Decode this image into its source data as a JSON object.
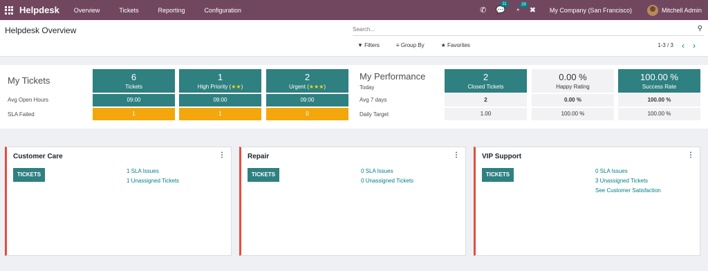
{
  "app": {
    "name": "Helpdesk",
    "menu": [
      "Overview",
      "Tickets",
      "Reporting",
      "Configuration"
    ]
  },
  "topbar": {
    "chat_badge": "11",
    "activity_badge": "29",
    "company": "My Company (San Francisco)",
    "user": "Mitchell Admin"
  },
  "control": {
    "title": "Helpdesk Overview",
    "search_placeholder": "Search...",
    "filters": "Filters",
    "group_by": "Group By",
    "favorites": "Favorites",
    "pager": "1-3 / 3"
  },
  "my_tickets": {
    "title": "My Tickets",
    "row_labels": [
      "Avg Open Hours",
      "SLA Failed"
    ],
    "cards": [
      {
        "value": "6",
        "label": "Tickets",
        "stars": "",
        "avg_open": "09:00",
        "sla_failed": "1"
      },
      {
        "value": "1",
        "label": "High Priority",
        "stars": "★★",
        "avg_open": "09:00",
        "sla_failed": "1"
      },
      {
        "value": "2",
        "label": "Urgent",
        "stars": "★★★",
        "avg_open": "09:00",
        "sla_failed": "0"
      }
    ]
  },
  "performance": {
    "title": "My Performance",
    "row_labels": [
      "Today",
      "Avg 7 days",
      "Daily Target"
    ],
    "cards": [
      {
        "value": "2",
        "label": "Closed Tickets",
        "avg7": "2",
        "target": "1.00"
      },
      {
        "value": "0.00 %",
        "label": "Happy Rating",
        "avg7": "0.00 %",
        "target": "100.00 %"
      },
      {
        "value": "100.00 %",
        "label": "Success Rate",
        "avg7": "100.00 %",
        "target": "100.00 %"
      }
    ]
  },
  "teams": [
    {
      "name": "Customer Care",
      "button": "TICKETS",
      "links": [
        "1 SLA Issues",
        "1 Unassigned Tickets"
      ]
    },
    {
      "name": "Repair",
      "button": "TICKETS",
      "links": [
        "0 SLA Issues",
        "0 Unassigned Tickets"
      ]
    },
    {
      "name": "VIP Support",
      "button": "TICKETS",
      "links": [
        "0 SLA Issues",
        "3 Unassigned Tickets",
        "See Customer Satisfaction"
      ]
    }
  ],
  "colors": {
    "topbar": "#71475f",
    "teal": "#2f8080",
    "orange": "#f3a70c",
    "team_border": "#e74c3c"
  }
}
